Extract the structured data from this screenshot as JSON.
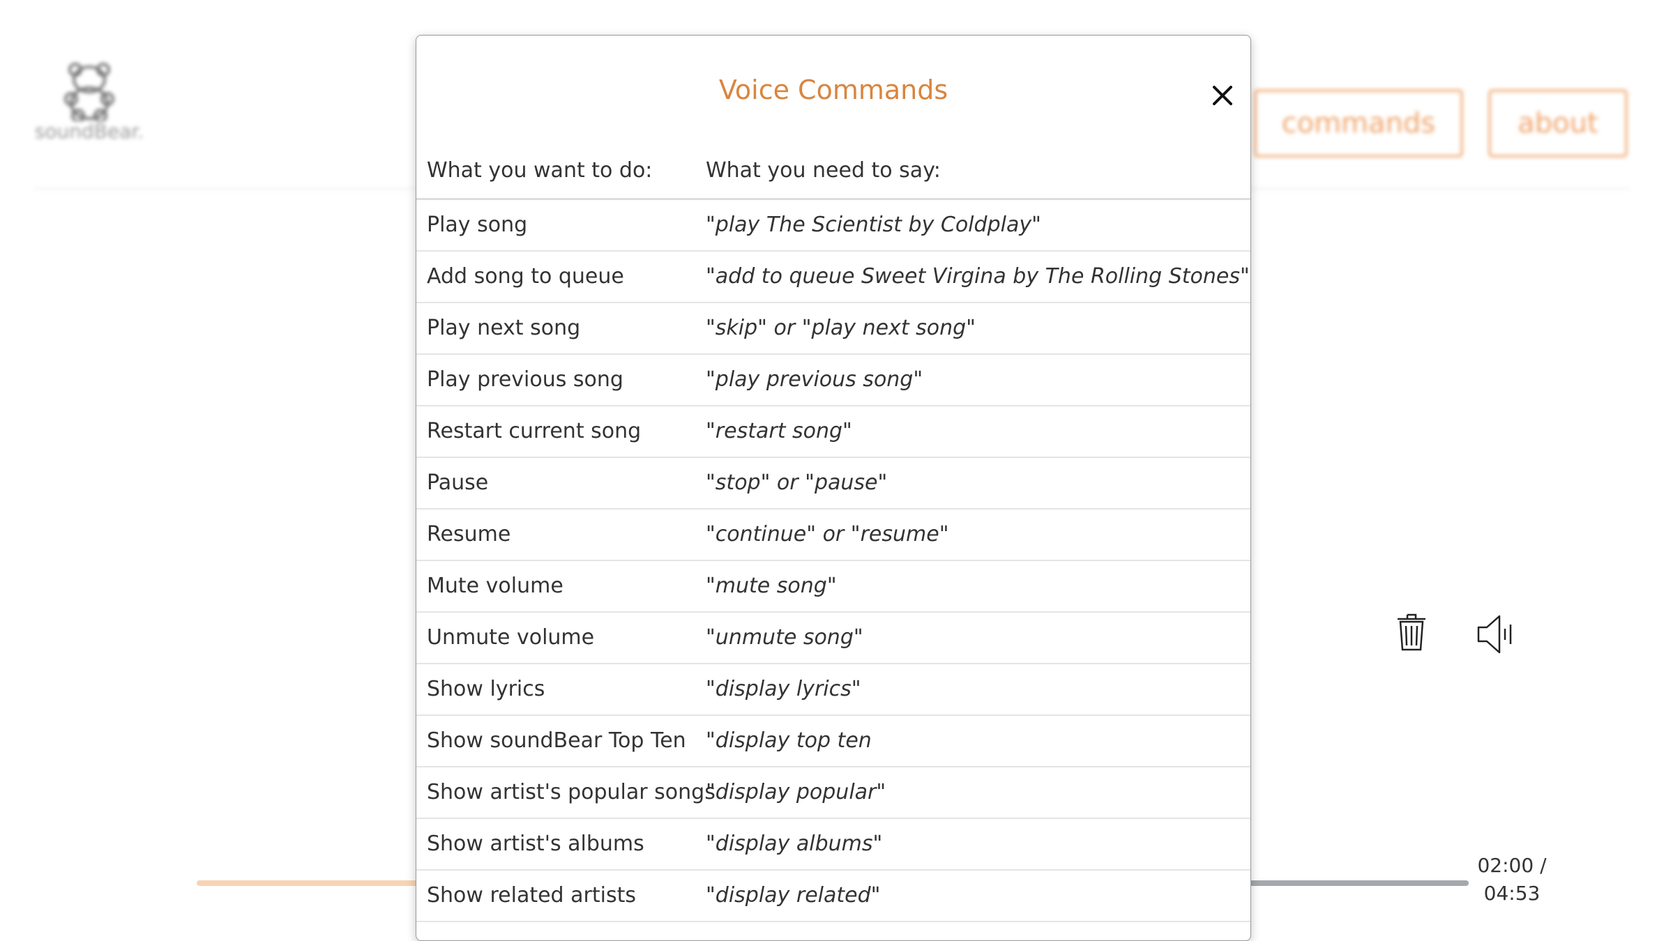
{
  "app": {
    "logo_text": "soundBear."
  },
  "nav": {
    "commands_label": "commands",
    "about_label": "about"
  },
  "player": {
    "time_current": "02:00 /",
    "time_total": "04:53",
    "progress": 0.41
  },
  "modal": {
    "title": "Voice Commands",
    "col_action": "What you want to do:",
    "col_say": "What you need to say:",
    "rows": [
      {
        "action": "Play song",
        "say": "\"play The Scientist by Coldplay\""
      },
      {
        "action": "Add song to queue",
        "say": "\"add to queue Sweet Virgina by The Rolling Stones\""
      },
      {
        "action": "Play next song",
        "say": "\"skip\" or \"play next song\""
      },
      {
        "action": "Play previous song",
        "say": "\"play previous song\""
      },
      {
        "action": "Restart current song",
        "say": "\"restart song\""
      },
      {
        "action": "Pause",
        "say": "\"stop\" or \"pause\""
      },
      {
        "action": "Resume",
        "say": "\"continue\" or \"resume\""
      },
      {
        "action": "Mute volume",
        "say": "\"mute song\""
      },
      {
        "action": "Unmute volume",
        "say": "\"unmute song\""
      },
      {
        "action": "Show lyrics",
        "say": "\"display lyrics\""
      },
      {
        "action": "Show soundBear Top Ten",
        "say": "\"display top ten"
      },
      {
        "action": "Show artist's popular songs",
        "say": "\"display popular\""
      },
      {
        "action": "Show artist's albums",
        "say": "\"display albums\""
      },
      {
        "action": "Show related artists",
        "say": "\"display related\""
      }
    ]
  },
  "colors": {
    "accent": "#d9853f",
    "nav_border": "#f3b98b",
    "progress_played": "#f8d3b3",
    "progress_remaining": "#a4a8ae"
  }
}
